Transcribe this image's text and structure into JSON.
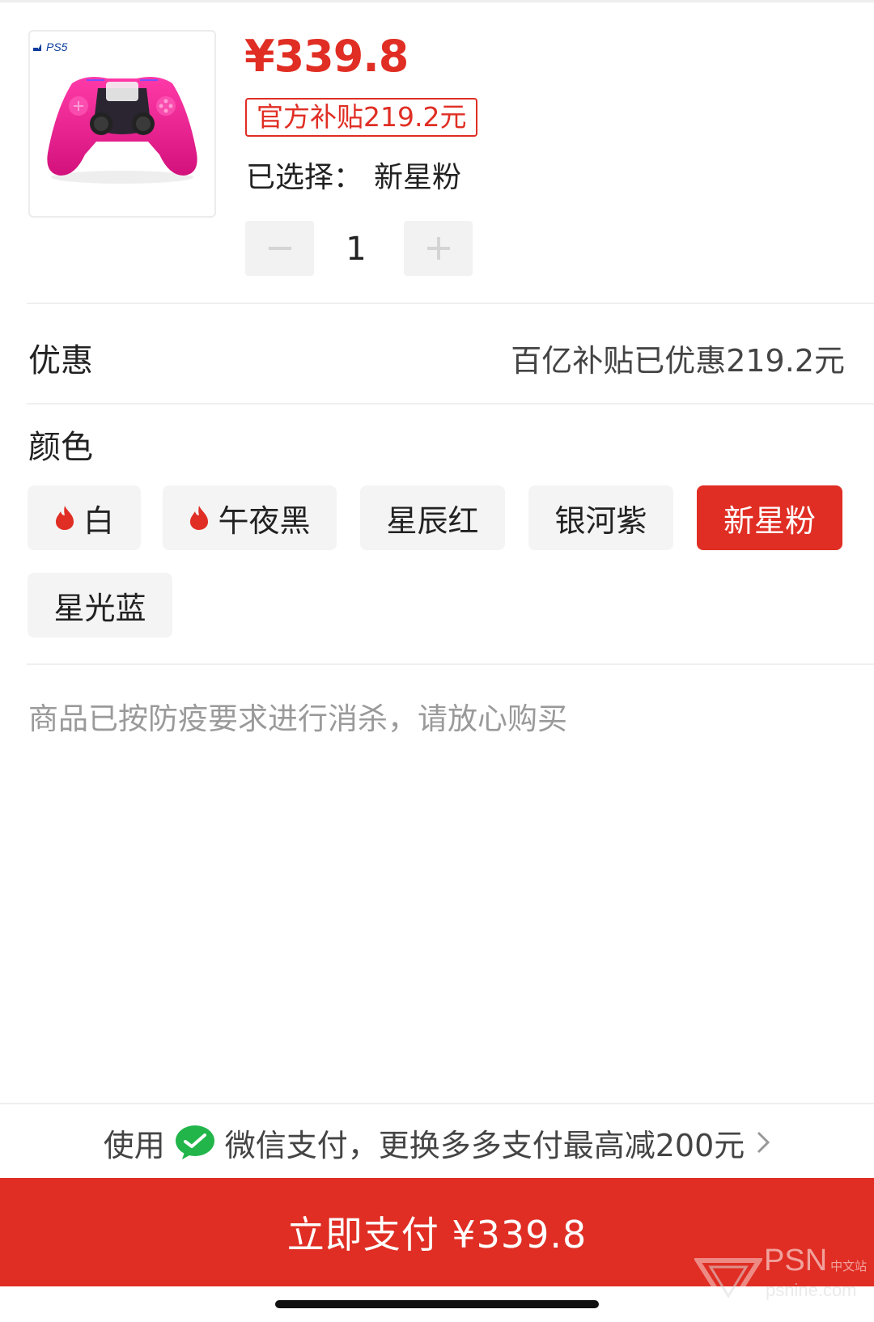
{
  "product": {
    "image_icon": "pink-ps5-controller-image",
    "box_brand": "PS5",
    "price": "¥339.8",
    "subsidy_tag": "官方补贴219.2元",
    "selected_label": "已选择：",
    "selected_value": "新星粉"
  },
  "quantity": {
    "value": "1",
    "minus_icon": "minus-icon",
    "plus_icon": "plus-icon"
  },
  "discount": {
    "label": "优惠",
    "value": "百亿补贴已优惠219.2元"
  },
  "color": {
    "label": "颜色",
    "options": [
      {
        "label": "白",
        "hot": true,
        "selected": false
      },
      {
        "label": "午夜黑",
        "hot": true,
        "selected": false
      },
      {
        "label": "星辰红",
        "hot": false,
        "selected": false
      },
      {
        "label": "银河紫",
        "hot": false,
        "selected": false
      },
      {
        "label": "新星粉",
        "hot": false,
        "selected": true
      },
      {
        "label": "星光蓝",
        "hot": false,
        "selected": false
      }
    ]
  },
  "notice": "商品已按防疫要求进行消杀，请放心购买",
  "payment": {
    "prefix": "使用",
    "method_icon": "wechat-pay-icon",
    "text": "微信支付，更换多多支付最高减200元",
    "chevron_icon": "chevron-right-icon"
  },
  "pay_button": "立即支付 ¥339.8",
  "watermark": {
    "brand": "PSN",
    "sub": "中文站",
    "url": "psnine.com"
  },
  "colors": {
    "accent": "#e02e24",
    "chip_bg": "#f4f4f4",
    "text": "#222222",
    "muted": "#9a9a9a"
  }
}
